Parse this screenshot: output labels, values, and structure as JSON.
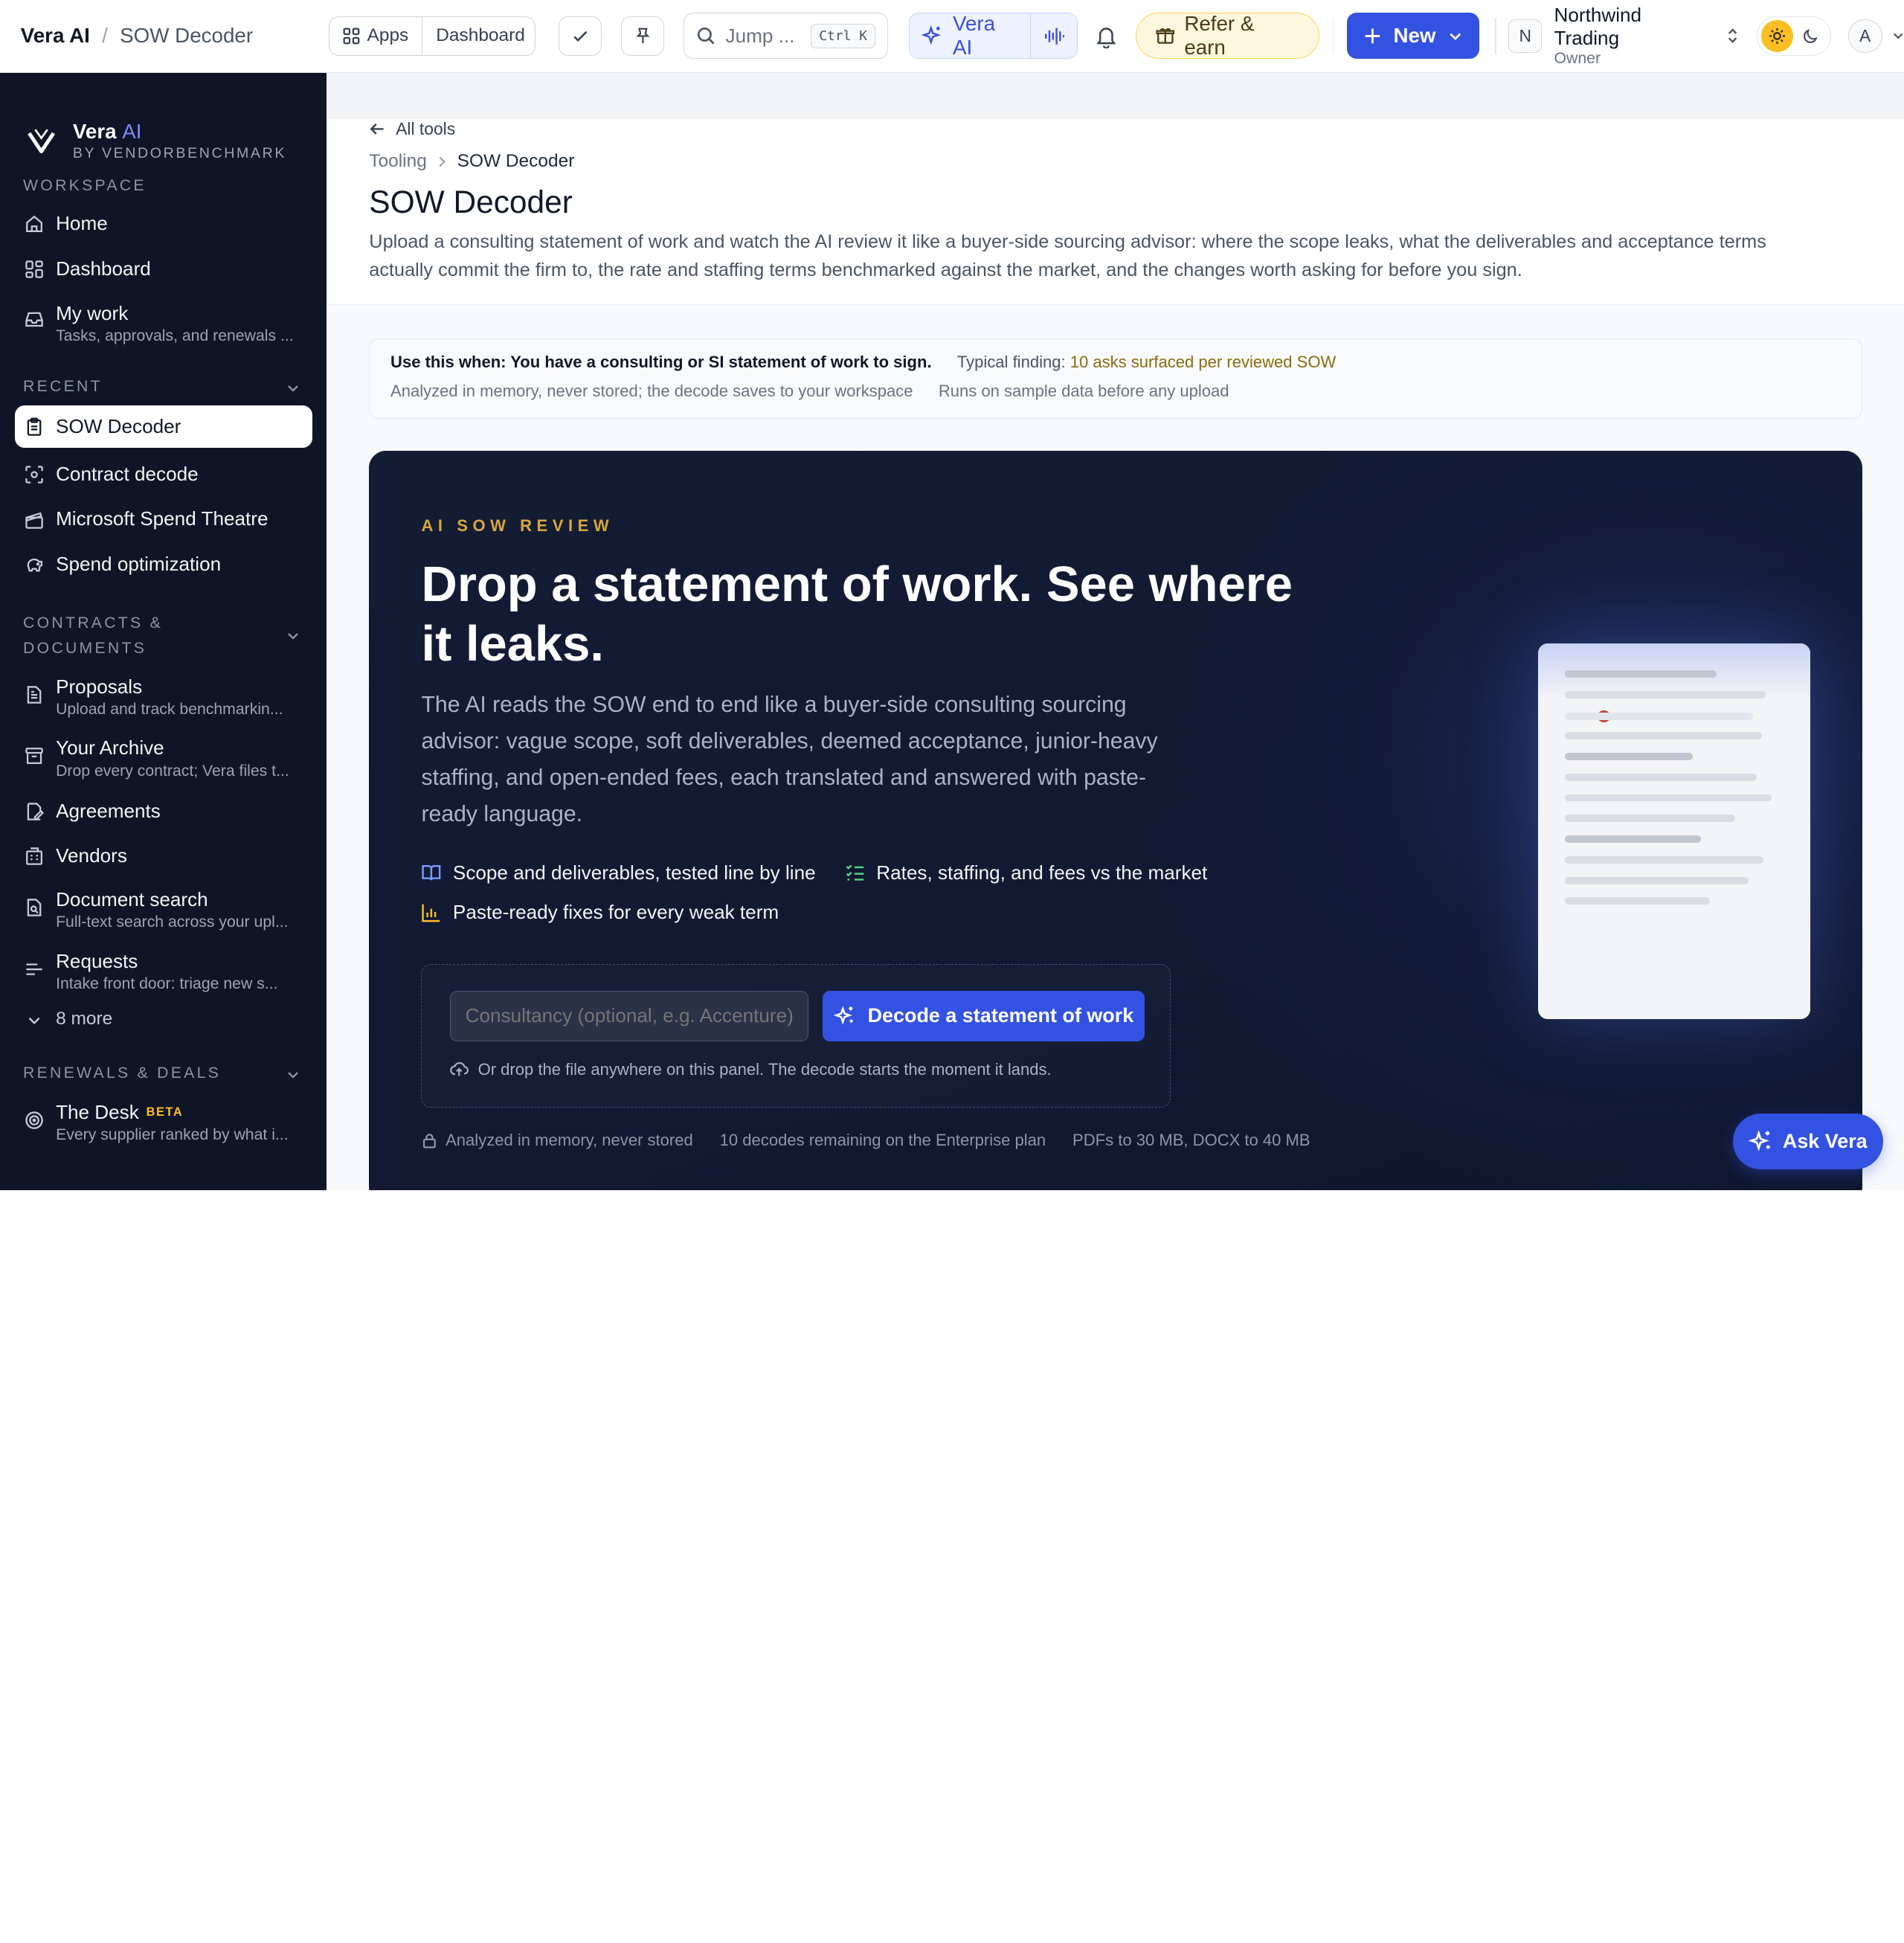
{
  "topbar": {
    "app_name": "Vera AI",
    "page_name": "SOW Decoder",
    "apps_label": "Apps",
    "dashboard_label": "Dashboard",
    "search_placeholder": "Jump ...",
    "search_shortcut": "Ctrl K",
    "vera_label": "Vera AI",
    "refer_label": "Refer & earn",
    "new_label": "New",
    "org_initial": "N",
    "org_name": "Northwind Trading",
    "org_role": "Owner",
    "user_initial": "A"
  },
  "sidebar": {
    "brand_name": "Vera",
    "brand_ai": "AI",
    "brand_by": "BY VENDORBENCHMARK",
    "workspace_label": "WORKSPACE",
    "workspace_items": [
      {
        "label": "Home",
        "icon": "home-icon"
      },
      {
        "label": "Dashboard",
        "icon": "dashboard-icon"
      },
      {
        "label": "My work",
        "sub": "Tasks, approvals, and renewals ...",
        "icon": "inbox-icon"
      }
    ],
    "recent_label": "RECENT",
    "recent_items": [
      {
        "label": "SOW Decoder",
        "icon": "clipboard-icon",
        "active": true
      },
      {
        "label": "Contract decode",
        "icon": "scan-icon"
      },
      {
        "label": "Microsoft Spend Theatre",
        "icon": "clapper-icon"
      },
      {
        "label": "Spend optimization",
        "icon": "piggy-icon"
      }
    ],
    "contracts_label_1": "CONTRACTS &",
    "contracts_label_2": "DOCUMENTS",
    "contracts_items": [
      {
        "label": "Proposals",
        "sub": "Upload and track benchmarkin...",
        "icon": "document-icon"
      },
      {
        "label": "Your Archive",
        "sub": "Drop every contract; Vera files t...",
        "icon": "archive-icon"
      },
      {
        "label": "Agreements",
        "icon": "signature-icon"
      },
      {
        "label": "Vendors",
        "icon": "building-icon"
      },
      {
        "label": "Document search",
        "sub": "Full-text search across your upl...",
        "icon": "file-search-icon"
      },
      {
        "label": "Requests",
        "sub": "Intake front door: triage new s...",
        "icon": "list-icon"
      }
    ],
    "more_label": "8 more",
    "renewals_label": "RENEWALS & DEALS",
    "desk_label": "The Desk",
    "desk_badge": "BETA",
    "desk_sub": "Every supplier ranked by what i..."
  },
  "page": {
    "back_label": "All tools",
    "breadcrumb_parent": "Tooling",
    "breadcrumb_current": "SOW Decoder",
    "title": "SOW Decoder",
    "description": "Upload a consulting statement of work and watch the AI review it like a buyer-side sourcing advisor: where the scope leaks, what the deliverables and acceptance terms actually commit the firm to, the rate and staffing terms benchmarked against the market, and the changes worth asking for before you sign."
  },
  "usewhen": {
    "lead": "Use this when: You have a consulting or SI statement of work to sign.",
    "typical_prefix": "Typical finding: ",
    "typical_value": "10 asks surfaced per reviewed SOW",
    "note_1": "Analyzed in memory, never stored; the decode saves to your workspace",
    "note_2": "Runs on sample data before any upload"
  },
  "hero": {
    "eyebrow": "AI SOW REVIEW",
    "title": "Drop a statement of work. See where it leaks.",
    "description": "The AI reads the SOW end to end like a buyer-side consulting sourcing advisor: vague scope, soft deliverables, deemed acceptance, junior-heavy staffing, and open-ended fees, each translated and answered with paste-ready language.",
    "feature_1": "Scope and deliverables, tested line by line",
    "feature_2": "Rates, staffing, and fees vs the market",
    "feature_3": "Paste-ready fixes for every weak term",
    "input_placeholder": "Consultancy (optional, e.g. Accenture)",
    "input_value": "",
    "decode_label": "Decode a statement of work",
    "drop_hint": "Or drop the file anywhere on this panel. The decode starts the moment it lands.",
    "foot_1": "Analyzed in memory, never stored",
    "foot_2": "10 decodes remaining on the Enterprise plan",
    "foot_3": "PDFs to 30 MB, DOCX to 40 MB"
  },
  "ask_vera_label": "Ask Vera",
  "colors": {
    "accent": "#3452e1",
    "sidebar_bg": "#0f1526",
    "hero_bg": "#141c34",
    "eyebrow_gold": "#d7a73a"
  }
}
